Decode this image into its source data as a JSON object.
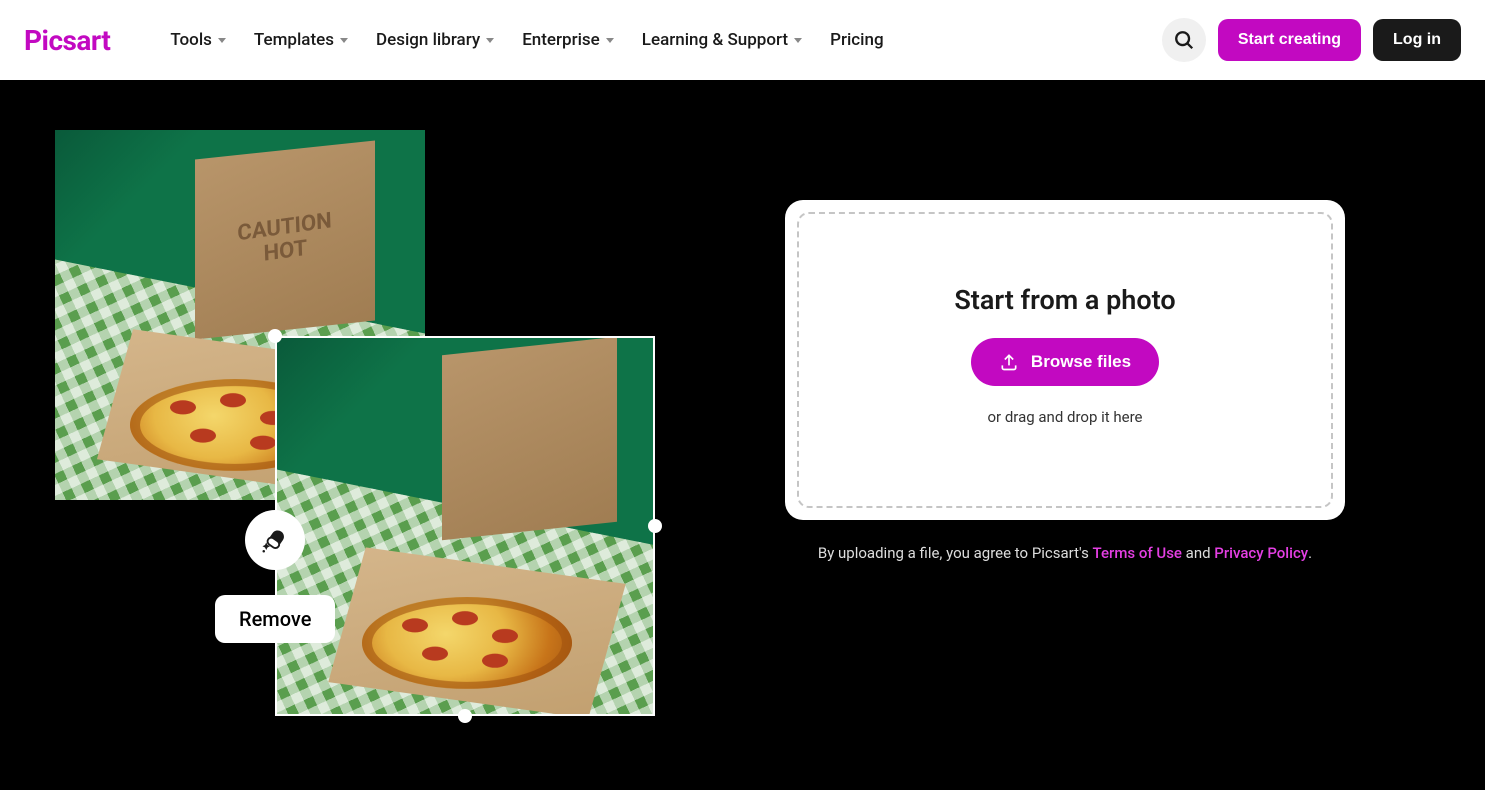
{
  "brand": {
    "logo": "Picsart"
  },
  "nav": {
    "items": [
      {
        "label": "Tools",
        "dropdown": true
      },
      {
        "label": "Templates",
        "dropdown": true
      },
      {
        "label": "Design library",
        "dropdown": true
      },
      {
        "label": "Enterprise",
        "dropdown": true
      },
      {
        "label": "Learning & Support",
        "dropdown": true
      },
      {
        "label": "Pricing",
        "dropdown": false
      }
    ]
  },
  "header": {
    "start_creating": "Start creating",
    "login": "Log in"
  },
  "preview": {
    "box_text_line1": "CAUTION",
    "box_text_line2": "HOT",
    "remove_label": "Remove"
  },
  "upload": {
    "title": "Start from a photo",
    "browse": "Browse files",
    "hint": "or drag and drop it here"
  },
  "disclaimer": {
    "prefix": "By uploading a file, you agree to Picsart's ",
    "terms": "Terms of Use",
    "and": " and ",
    "privacy": "Privacy Policy",
    "suffix": "."
  },
  "colors": {
    "accent": "#c209c1"
  }
}
